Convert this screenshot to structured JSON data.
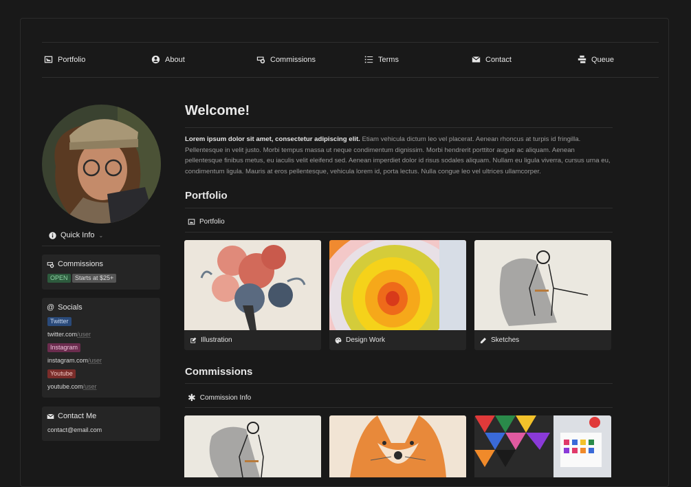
{
  "nav": [
    {
      "label": "Portfolio",
      "icon": "image-icon"
    },
    {
      "label": "About",
      "icon": "user-circle-icon"
    },
    {
      "label": "Commissions",
      "icon": "money-icon"
    },
    {
      "label": "Terms",
      "icon": "list-icon"
    },
    {
      "label": "Contact",
      "icon": "envelope-icon"
    },
    {
      "label": "Queue",
      "icon": "queue-icon"
    }
  ],
  "sidebar": {
    "quick_info": "Quick Info",
    "commissions": {
      "title": "Commissions",
      "status": "OPEN",
      "price": "Starts at $25+"
    },
    "socials": {
      "title": "Socials",
      "items": [
        {
          "tag": "Twitter",
          "domain": "twitter.com",
          "path": "/user",
          "color": "#2a4a7a"
        },
        {
          "tag": "Instagram",
          "domain": "instagram.com",
          "path": "/user",
          "color": "#6b2c4e"
        },
        {
          "tag": "Youtube",
          "domain": "youtube.com",
          "path": "/user",
          "color": "#7a2d2a"
        }
      ]
    },
    "contact": {
      "title": "Contact Me",
      "email": "contact@email.com"
    }
  },
  "main": {
    "welcome_title": "Welcome!",
    "intro_bold": "Lorem ipsum dolor sit amet, consectetur adipiscing elit.",
    "intro_text": " Etiam vehicula dictum leo vel placerat. Aenean rhoncus at turpis id fringilla. Pellentesque in velit justo. Morbi tempus massa ut neque condimentum dignissim. Morbi hendrerit porttitor augue ac aliquam. Aenean pellentesque finibus metus, eu iaculis velit eleifend sed. Aenean imperdiet dolor id risus sodales aliquam. Nullam eu ligula viverra, cursus urna eu, condimentum ligula. Mauris at eros pellentesque, vehicula lorem id, porta lectus. Nulla congue leo vel ultrices ullamcorper.",
    "portfolio_heading": "Portfolio",
    "portfolio_sub": "Portfolio",
    "gallery": [
      {
        "label": "Illustration",
        "icon": "edit-icon"
      },
      {
        "label": "Design Work",
        "icon": "palette-icon"
      },
      {
        "label": "Sketches",
        "icon": "pencil-icon"
      }
    ],
    "commissions_heading": "Commissions",
    "commissions_sub": "Commission Info"
  },
  "colors": {
    "background": "#191919",
    "card": "#252525",
    "open_tag": "#2d5a3d",
    "price_tag": "#555555"
  }
}
